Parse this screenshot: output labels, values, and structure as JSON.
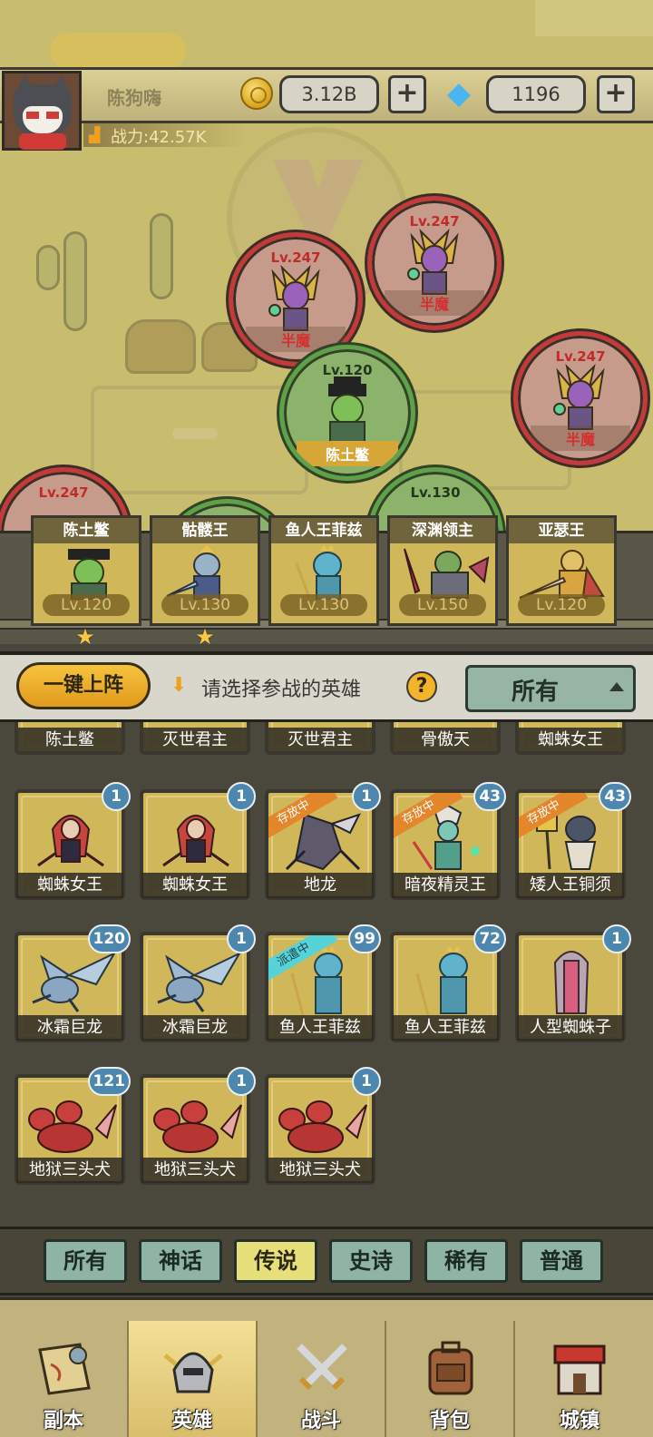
{
  "player": {
    "name": "陈狗嗨",
    "power": "战力:42.57K",
    "coins": "3.12B",
    "gems": "1196",
    "plus": "+"
  },
  "map_units": {
    "enemies": [
      {
        "level": "Lv.247",
        "name": "半魔"
      },
      {
        "level": "Lv.247",
        "name": "半魔"
      },
      {
        "level": "Lv.247",
        "name": "半魔"
      },
      {
        "level": "Lv.247",
        "name": ""
      }
    ],
    "allies": [
      {
        "level": "Lv.120",
        "name": "陈土鳖"
      },
      {
        "level": "Lv.130",
        "name": ""
      }
    ]
  },
  "team": [
    {
      "name": "陈土鳖",
      "level": "Lv.120",
      "star": "★"
    },
    {
      "name": "骷髅王",
      "level": "Lv.130",
      "star": "★"
    },
    {
      "name": "鱼人王菲兹",
      "level": "Lv.130"
    },
    {
      "name": "深渊领主",
      "level": "Lv.150"
    },
    {
      "name": "亚瑟王",
      "level": "Lv.120"
    }
  ],
  "filter": {
    "quick_deploy": "一键上阵",
    "hint_arrow": "⬇",
    "hint": "请选择参战的英雄",
    "help": "?",
    "dropdown_value": "所有"
  },
  "hero_rows": {
    "partial": [
      "陈土鳖",
      "灭世君主",
      "灭世君主",
      "骨傲天",
      "蜘蛛女王"
    ],
    "row1": [
      {
        "name": "蜘蛛女王",
        "count": "1",
        "tag": ""
      },
      {
        "name": "蜘蛛女王",
        "count": "1",
        "tag": ""
      },
      {
        "name": "地龙",
        "count": "1",
        "tag": "存放中"
      },
      {
        "name": "暗夜精灵王",
        "count": "43",
        "tag": "存放中"
      },
      {
        "name": "矮人王铜须",
        "count": "43",
        "tag": "存放中"
      }
    ],
    "row2": [
      {
        "name": "冰霜巨龙",
        "count": "120",
        "tag": ""
      },
      {
        "name": "冰霜巨龙",
        "count": "1",
        "tag": ""
      },
      {
        "name": "鱼人王菲兹",
        "count": "99",
        "tag": "派遣中"
      },
      {
        "name": "鱼人王菲兹",
        "count": "72",
        "tag": ""
      },
      {
        "name": "人型蜘蛛子",
        "count": "1",
        "tag": ""
      }
    ],
    "row3": [
      {
        "name": "地狱三头犬",
        "count": "121",
        "tag": ""
      },
      {
        "name": "地狱三头犬",
        "count": "1",
        "tag": ""
      },
      {
        "name": "地狱三头犬",
        "count": "1",
        "tag": ""
      }
    ]
  },
  "rarity_tabs": [
    "所有",
    "神话",
    "传说",
    "史诗",
    "稀有",
    "普通"
  ],
  "active_rarity": "传说",
  "nav": [
    "副本",
    "英雄",
    "战斗",
    "背包",
    "城镇"
  ],
  "active_nav": "英雄",
  "colors": {
    "enemy_ring": "#c23a3a",
    "ally_ring": "#5fa04a",
    "card_bg": "#d0b75a",
    "badge": "#4d87ad",
    "store_ribbon": "#e4862a",
    "dispatch_ribbon": "#56d3d8",
    "quick_button": "#f0b02a"
  }
}
